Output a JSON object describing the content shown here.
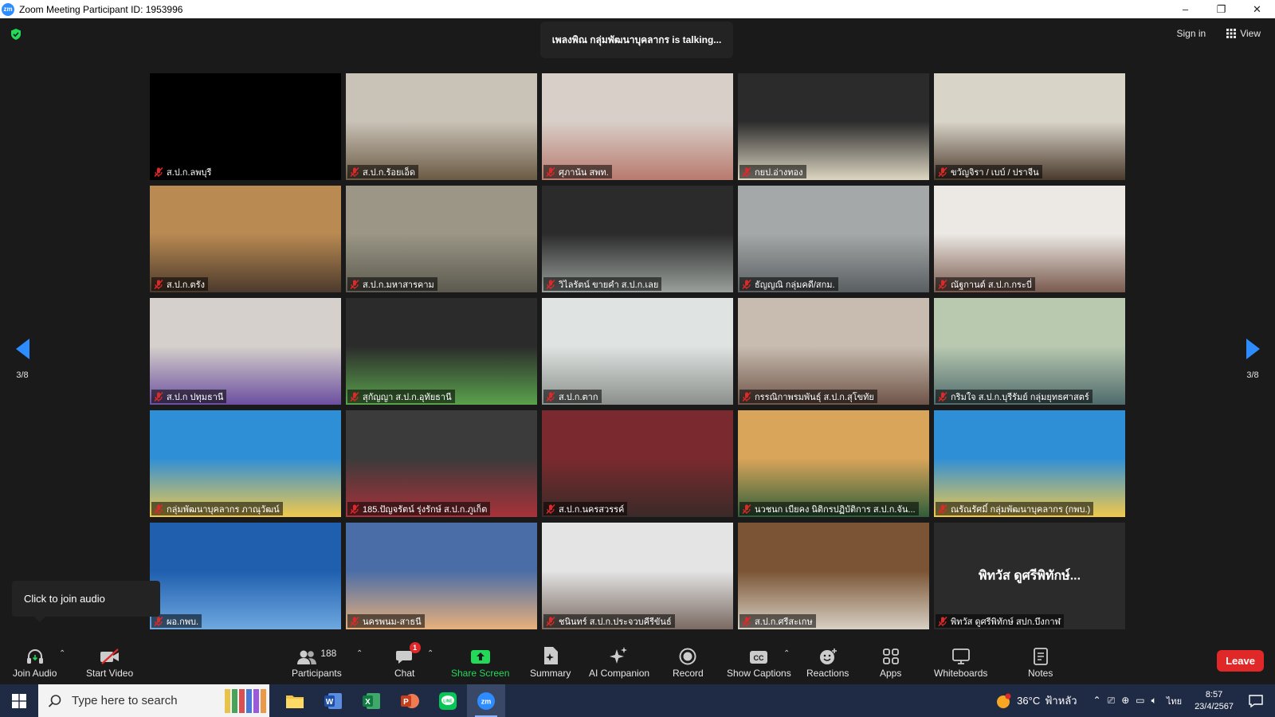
{
  "window": {
    "title": "Zoom Meeting Participant ID: 1953996",
    "logo_text": "zm",
    "controls": [
      "–",
      "❐",
      "✕"
    ]
  },
  "header": {
    "talking_text": "เพลงพิณ กลุ่มพัฒนาบุคลากร is  talking...",
    "sign_in": "Sign in",
    "view": "View"
  },
  "pagination": {
    "left": "3/8",
    "right": "3/8"
  },
  "participants": [
    {
      "name": "ส.ป.ก.ลพบุรี",
      "bg": "#000000",
      "bg2": "#000000"
    },
    {
      "name": "ส.ป.ก.ร้อยเอ็ด",
      "bg": "#c9c2b6",
      "bg2": "#6b5a44"
    },
    {
      "name": "ศุภาน้น สพท.",
      "bg": "#d8cfc8",
      "bg2": "#b97a6e"
    },
    {
      "name": "กยป.อ่างทอง",
      "bg": "#2b2b2b",
      "bg2": "#ddd6c2"
    },
    {
      "name": "ขวัญจิรา / เบบ์ / ปราจีน",
      "bg": "#d9d4c8",
      "bg2": "#4a3a2c"
    },
    {
      "name": "ส.ป.ก.ตรัง",
      "bg": "#b98a52",
      "bg2": "#4c3a2d"
    },
    {
      "name": "ส.ป.ก.มหาสารคาม",
      "bg": "#9b9685",
      "bg2": "#5c5a50"
    },
    {
      "name": "วิไลรัตน์ ขายคำ ส.ป.ก.เลย",
      "bg": "#2b2b2b",
      "bg2": "#9aa09c"
    },
    {
      "name": "ธัญญณิ กลุ่มคดี/สกม.",
      "bg": "#a4a8a8",
      "bg2": "#5a5f62"
    },
    {
      "name": "ณัฐกานต์ ส.ป.ก.กระบี่",
      "bg": "#ece9e4",
      "bg2": "#7a5a4e"
    },
    {
      "name": "ส.ป.ก ปทุมธานี",
      "bg": "#d5d0cb",
      "bg2": "#6c4fa0"
    },
    {
      "name": "สุกัญญา ส.ป.ก.อุทัยธานี",
      "bg": "#2b2b2b",
      "bg2": "#5aa24c"
    },
    {
      "name": "ส.ป.ก.ตาก",
      "bg": "#dfe4e2",
      "bg2": "#8b8f8c"
    },
    {
      "name": "กรรณิกาพรมพันธุ์ ส.ป.ก.สุโขทัย",
      "bg": "#c8bcb0",
      "bg2": "#6f5448"
    },
    {
      "name": "กริมใจ ส.ป.ก.บุรีรัมย์ กลุ่มยุทธศาสตร์",
      "bg": "#b8c9b0",
      "bg2": "#4f6a6c"
    },
    {
      "name": "กลุ่มพัฒนาบุคลากร ภาณุวัฒน์",
      "bg": "#2f8fd6",
      "bg2": "#f2c94c"
    },
    {
      "name": "185.ปัญจรัตน์ รุ่งรักษ์ ส.ป.ก.ภูเก็ต",
      "bg": "#3b3b3b",
      "bg2": "#a8323a"
    },
    {
      "name": "ส.ป.ก.นครสวรรค์",
      "bg": "#7a2a2e",
      "bg2": "#3a2a28"
    },
    {
      "name": "นวชนก เบียคง นิติกรปฏิบัติการ ส.ป.ก.จัน...",
      "bg": "#d9a55a",
      "bg2": "#2f5e3a"
    },
    {
      "name": "ณรัณรัศมิ์ กลุ่มพัฒนาบุคลากร (กพบ.)",
      "bg": "#2f8fd6",
      "bg2": "#f2c94c"
    },
    {
      "name": "ผอ.กพบ.",
      "bg": "#1f5fae",
      "bg2": "#6fa8e0"
    },
    {
      "name": "นครพนม-สาธนี",
      "bg": "#4a6da8",
      "bg2": "#e8b07a"
    },
    {
      "name": "ชนินทร์ ส.ป.ก.ประจวบคีรีขันธ์",
      "bg": "#e4e4e4",
      "bg2": "#7a6a62"
    },
    {
      "name": "ส.ป.ก.ศรีสะเกษ",
      "bg": "#7a5434",
      "bg2": "#d8d0c4"
    },
    {
      "name": "พิทวัส ดูศรีพิทักษ์ สปก.บึงกาฬ",
      "bg": "#2b2b2b",
      "bg2": "#2b2b2b",
      "big_name": "พิทวัส ดูศรีพิทักษ์..."
    }
  ],
  "tooltip": {
    "text": "Click to join audio"
  },
  "toolbar": {
    "join_audio": "Join Audio",
    "start_video": "Start Video",
    "participants": "Participants",
    "participants_count": "188",
    "chat": "Chat",
    "chat_badge": "1",
    "share_screen": "Share Screen",
    "summary": "Summary",
    "ai_companion": "AI Companion",
    "record": "Record",
    "show_captions": "Show Captions",
    "reactions": "Reactions",
    "apps": "Apps",
    "whiteboards": "Whiteboards",
    "notes": "Notes",
    "leave": "Leave"
  },
  "taskbar": {
    "search_placeholder": "Type here to search",
    "temperature": "36°C",
    "weather": "ฟ้าหลัว",
    "language": "ไทย",
    "time": "8:57",
    "date": "23/4/2567"
  },
  "colors": {
    "accent_blue": "#2d8cff",
    "share_green": "#23d959",
    "leave_red": "#e02828",
    "mic_muted_red": "#e02828"
  }
}
